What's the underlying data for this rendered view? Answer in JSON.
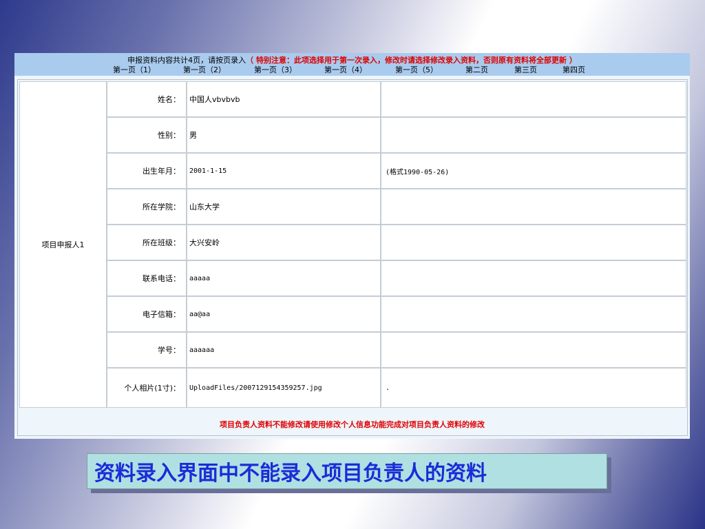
{
  "header": {
    "intro": "申报资料内容共计4页，请按页录入",
    "warning": "（ 特别注意：此项选择用于第一次录入，修改时请选择修改录入资料，否则原有资料将全部更新 ）",
    "pages": [
      "第一页（1）",
      "第一页（2）",
      "第一页（3）",
      "第一页（4）",
      "第一页（5）",
      "第二页",
      "第三页",
      "第四页"
    ]
  },
  "form": {
    "section_label": "项目申报人1",
    "rows": [
      {
        "label": "姓名：",
        "value": "中国人vbvbvb",
        "note": ""
      },
      {
        "label": "性别：",
        "value": "男",
        "note": ""
      },
      {
        "label": "出生年月：",
        "value": "2001-1-15",
        "note": "(格式1990-05-26)"
      },
      {
        "label": "所在学院：",
        "value": "山东大学",
        "note": ""
      },
      {
        "label": "所在班级：",
        "value": "大兴安岭",
        "note": ""
      },
      {
        "label": "联系电话：",
        "value": "aaaaa",
        "note": ""
      },
      {
        "label": "电子信箱：",
        "value": "aa@aa",
        "note": ""
      },
      {
        "label": "学号：",
        "value": "aaaaaa",
        "note": ""
      },
      {
        "label": "个人相片(1寸)：",
        "value": "UploadFiles/2007129154359257.jpg",
        "note": "."
      }
    ]
  },
  "footer_warning": "项目负责人资料不能修改请使用修改个人信息功能完成对项目负责人资料的修改",
  "caption": "资料录入界面中不能录入项目负责人的资料"
}
